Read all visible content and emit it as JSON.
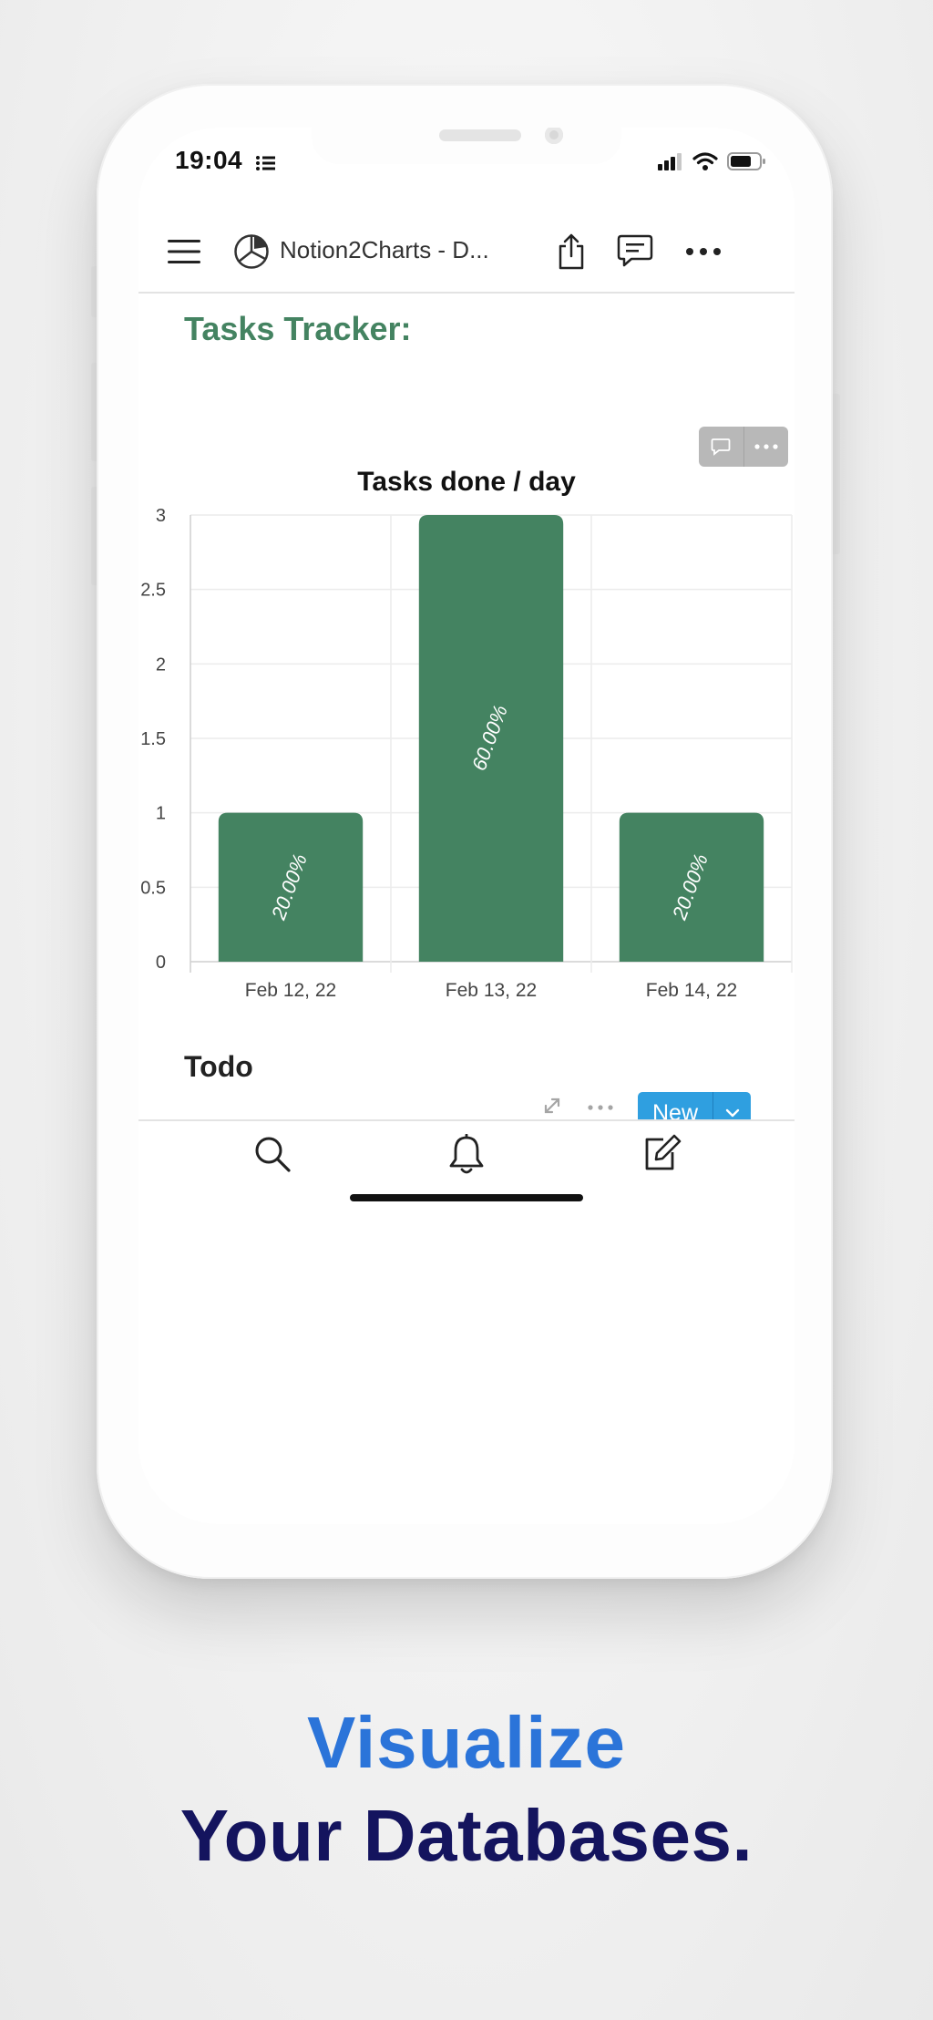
{
  "status_bar": {
    "time": "19:04"
  },
  "nav": {
    "title": "Notion2Charts - D..."
  },
  "page": {
    "section_title": "Tasks Tracker:",
    "todo_title": "Todo",
    "new_label": "New"
  },
  "icons": {
    "menu": "hamburger-icon",
    "app": "pie-chart-icon",
    "share": "share-icon",
    "comment": "comment-icon",
    "more": "more-horizontal-icon",
    "search": "search-icon",
    "bell": "bell-icon",
    "compose": "compose-icon",
    "expand": "expand-icon",
    "chevron": "chevron-down-icon"
  },
  "colors": {
    "accent_green": "#448361",
    "new_button": "#2f9fe0",
    "headline_blue": "#2b74d9",
    "headline_navy": "#14145e"
  },
  "chart_data": {
    "type": "bar",
    "title": "Tasks done / day",
    "categories": [
      "Feb 12, 22",
      "Feb 13, 22",
      "Feb 14, 22"
    ],
    "values": [
      1,
      3,
      1
    ],
    "data_labels": [
      "20.00%",
      "60.00%",
      "20.00%"
    ],
    "y_ticks": [
      "0",
      "0.5",
      "1",
      "1.5",
      "2",
      "2.5",
      "3"
    ],
    "ylim": [
      0,
      3
    ],
    "grid": true,
    "color": "#448361"
  },
  "headline": {
    "line1": "Visualize",
    "line2": "Your Databases."
  }
}
